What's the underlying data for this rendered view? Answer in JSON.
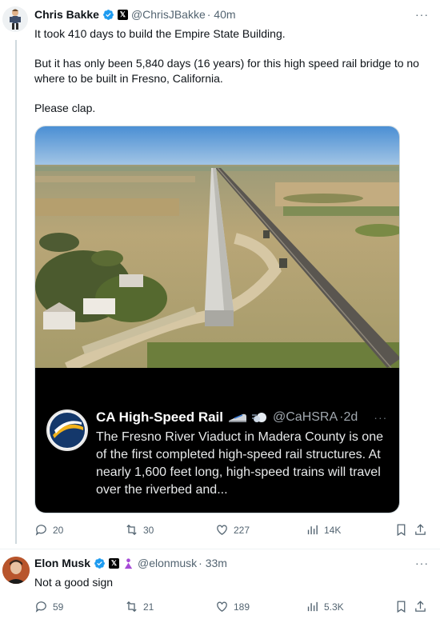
{
  "tweet1": {
    "name": "Chris Bakke",
    "handle": "@ChrisJBakke",
    "time": "· 40m",
    "more": "···",
    "text": [
      "It took 410 days to build the Empire State Building.",
      "But it has only been 5,840 days (16 years) for this high speed rail bridge to no where to be built in Fresno, California.",
      "Please clap."
    ],
    "quote": {
      "name": "CA High-Speed Rail",
      "handle": "@CaHSRA",
      "time": "·2d",
      "more": "···",
      "text": "The Fresno River Viaduct in Madera County is one of the first completed high-speed rail structures. At nearly 1,600 feet long, high-speed trains will travel over the riverbed and..."
    },
    "actions": {
      "replies": "20",
      "reposts": "30",
      "likes": "227",
      "views": "14K"
    }
  },
  "tweet2": {
    "name": "Elon Musk",
    "handle": "@elonmusk",
    "time": "· 33m",
    "more": "···",
    "text": "Not a good sign",
    "actions": {
      "replies": "59",
      "reposts": "21",
      "likes": "189",
      "views": "5.3K"
    }
  },
  "colors": {
    "verified": "#1d9bf0",
    "text": "#0f1419",
    "secondary": "#536471",
    "border": "#cfd9de",
    "quote_bg": "#000000"
  },
  "icons": [
    "reply-icon",
    "repost-icon",
    "like-icon",
    "views-icon",
    "bookmark-icon",
    "share-icon",
    "verified-icon",
    "x-badge-icon",
    "affiliate-icon"
  ]
}
